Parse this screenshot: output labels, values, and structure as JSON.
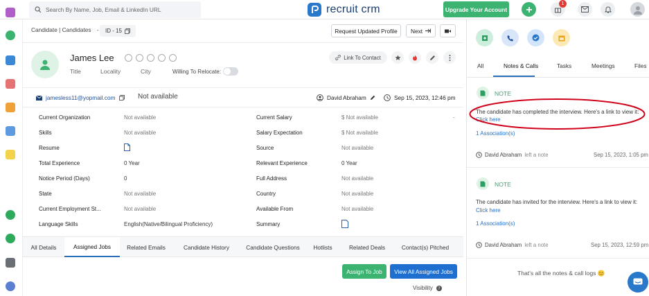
{
  "topbar": {
    "search_placeholder": "Search By Name, Job, Email & LinkedIn URL",
    "brand": "recruit crm",
    "upgrade_label": "Upgrade Your Account",
    "notification_count": "1"
  },
  "header": {
    "breadcrumb": "Candidate | Candidates",
    "separator": "-",
    "id_label": "ID - 15",
    "request_label": "Request Updated Profile",
    "next_label": "Next"
  },
  "candidate": {
    "name": "James Lee",
    "title_label": "Title",
    "locality_label": "Locality",
    "city_label": "City",
    "relocate_label": "Willing To Relocate:",
    "link_contact_label": "Link To Contact",
    "email": "jamesless11@yopmail.com",
    "phone": "Not available",
    "owner": "David Abraham",
    "created": "Sep 15, 2023, 12:46 pm"
  },
  "fields_left": [
    {
      "label": "Current Organization",
      "value": "Not available"
    },
    {
      "label": "Skills",
      "value": "Not available"
    },
    {
      "label": "Resume",
      "value": ""
    },
    {
      "label": "Total Experience",
      "value": "0 Year"
    },
    {
      "label": "Notice Period (Days)",
      "value": "0"
    },
    {
      "label": "State",
      "value": "Not available"
    },
    {
      "label": "Current Employment St...",
      "value": "Not available"
    },
    {
      "label": "Language Skills",
      "value": "English(Native/Bilingual Proficiency)"
    }
  ],
  "fields_right": [
    {
      "label": "Current Salary",
      "value": "$ Not available",
      "extra": "-"
    },
    {
      "label": "Salary Expectation",
      "value": "$ Not available"
    },
    {
      "label": "Source",
      "value": "Not available"
    },
    {
      "label": "Relevant Experience",
      "value": "0 Year"
    },
    {
      "label": "Full Address",
      "value": "Not available"
    },
    {
      "label": "Country",
      "value": "Not available"
    },
    {
      "label": "Available From",
      "value": "Not available"
    },
    {
      "label": "Summary",
      "value": ""
    }
  ],
  "tabs": [
    "All Details",
    "Assigned Jobs",
    "Related Emails",
    "Candidate History",
    "Candidate Questions",
    "Hotlists",
    "Related Deals",
    "Contact(s) Pitched"
  ],
  "actions": {
    "assign_label": "Assign To Job",
    "view_all_label": "View All Assigned Jobs",
    "visibility_label": "Visibility"
  },
  "right_tabs": [
    "All",
    "Notes & Calls",
    "Tasks",
    "Meetings",
    "Files"
  ],
  "notes": [
    {
      "type": "NOTE",
      "text": "The candidate has completed the interview. Here's a link to view it:",
      "link": "Click here",
      "associations": "1 Association(s)",
      "author": "David Abraham",
      "action": "left a note",
      "date": "Sep 15, 2023, 1:05 pm"
    },
    {
      "type": "NOTE",
      "text": "The candidate has invited for the interview. Here's a link to view it:",
      "link": "Click here",
      "associations": "1 Association(s)",
      "author": "David Abraham",
      "action": "left a note",
      "date": "Sep 15, 2023, 12:59 pm"
    }
  ],
  "end_text": "That's all the notes & call logs 😊",
  "colors": {
    "green": "#3cb371",
    "blue": "#1f6fd1",
    "highlight": "#d0021b"
  }
}
